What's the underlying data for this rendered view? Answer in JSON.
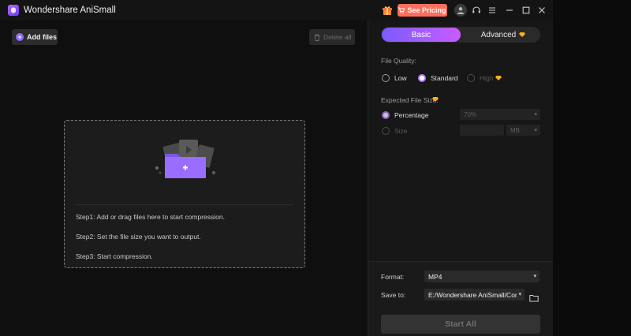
{
  "titlebar": {
    "app_title": "Wondershare AniSmall",
    "pricing_label": "See Pricing"
  },
  "toolbar": {
    "add_files_label": "Add files",
    "delete_all_label": "Delete all"
  },
  "dropzone": {
    "steps": [
      "Step1: Add or drag files here to start compression.",
      "Step2: Set the file size you want to output.",
      "Step3: Start compression."
    ]
  },
  "panel": {
    "tabs": [
      {
        "label": "Basic",
        "active": true
      },
      {
        "label": "Advanced",
        "active": false
      }
    ],
    "file_quality": {
      "label": "File Quality:",
      "options": [
        {
          "label": "Low",
          "selected": false,
          "disabled": false
        },
        {
          "label": "Standard",
          "selected": true,
          "disabled": false
        },
        {
          "label": "High",
          "selected": false,
          "disabled": true
        }
      ]
    },
    "expected_size": {
      "label": "Expected File Size:",
      "percentage_label": "Percentage",
      "percentage_value": "70%",
      "size_label": "Size",
      "size_value": "",
      "unit_value": "MB"
    }
  },
  "bottom": {
    "format_label": "Format:",
    "format_value": "MP4",
    "save_label": "Save to:",
    "save_value": "E:/Wondershare AniSmall/Comp",
    "start_label": "Start All"
  },
  "colors": {
    "accent": "#8e6cff",
    "pricing": "#ff6d5b",
    "gem": "#ffb020"
  }
}
